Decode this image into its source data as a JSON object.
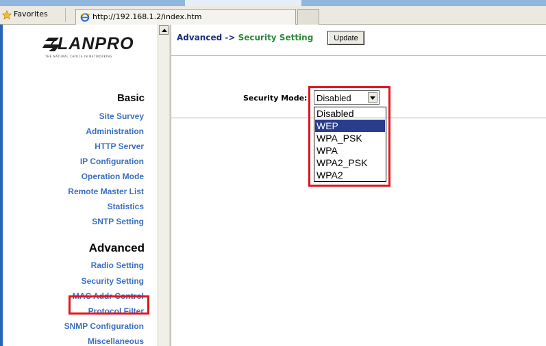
{
  "browser": {
    "favorites_label": "Favorites",
    "tab_url": "http://192.168.1.2/index.htm"
  },
  "sidebar": {
    "logo": {
      "name": "LANPRO",
      "tagline": "THE NATURAL CHOICE IN NETWORKING"
    },
    "basic": {
      "heading": "Basic",
      "items": [
        "Site Survey",
        "Administration",
        "HTTP Server",
        "IP Configuration",
        "Operation Mode",
        "Remote Master List",
        "Statistics",
        "SNTP Setting"
      ]
    },
    "advanced": {
      "heading": "Advanced",
      "items": [
        "Radio Setting",
        "Security Setting",
        "MAC Addr Control",
        "Protocol Filter",
        "SNMP Configuration",
        "Miscellaneous"
      ]
    }
  },
  "main": {
    "breadcrumb_prefix": "Advanced ->",
    "breadcrumb_current": "Security Setting",
    "update_label": "Update",
    "security_mode_label": "Security Mode:",
    "security_mode_value": "Disabled",
    "security_mode_options": [
      "Disabled",
      "WEP",
      "WPA_PSK",
      "WPA",
      "WPA2_PSK",
      "WPA2"
    ],
    "highlighted_option": "WEP"
  },
  "colors": {
    "highlight_box": "#e0141c",
    "nav_link": "#3a6fc2",
    "selected_option_bg": "#2a3d8c",
    "breadcrumb_current": "#2a8a3a"
  }
}
